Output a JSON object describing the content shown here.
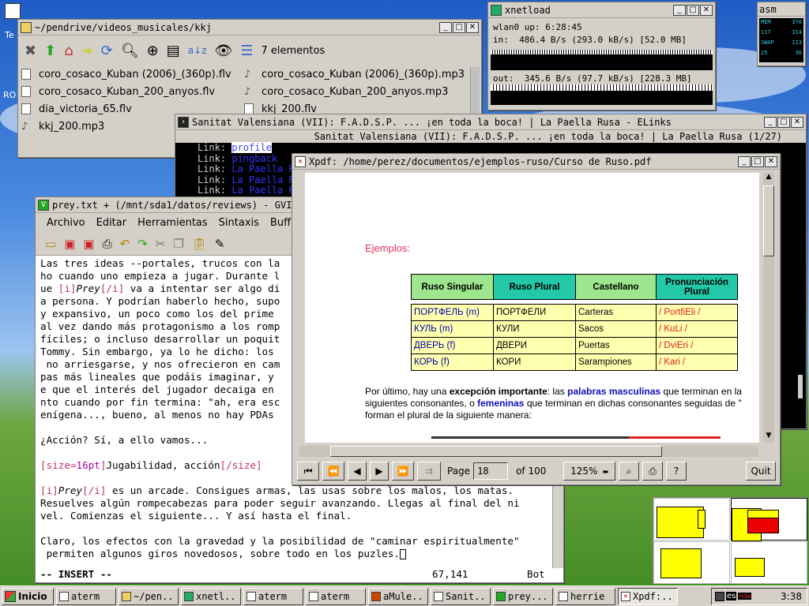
{
  "desktop": {
    "icon_top_label": "Te",
    "icon_left_label": "RO",
    "colors": {
      "sky": "#2f6fd4",
      "grass": "#4c9a2a"
    }
  },
  "filemanager": {
    "title": "~/pendrive/videos_musicales/kkj",
    "count": "7 elementos",
    "files": [
      {
        "name": "coro_cosaco_Kuban (2006)_(360p).flv",
        "icon": "video-file-icon"
      },
      {
        "name": "coro_cosaco_Kuban (2006)_(360p).mp3",
        "icon": "audio-file-icon"
      },
      {
        "name": "coro_cosaco_Kuban_200_anyos.flv",
        "icon": "video-file-icon"
      },
      {
        "name": "coro_cosaco_Kuban_200_anyos.mp3",
        "icon": "audio-file-icon"
      },
      {
        "name": "dia_victoria_65.flv",
        "icon": "video-file-icon"
      },
      {
        "name": "kkj_200.flv",
        "icon": "video-file-icon"
      },
      {
        "name": "kkj_200.mp3",
        "icon": "audio-file-icon"
      }
    ]
  },
  "xnetload": {
    "title": "xnetload",
    "up": "wlan0 up: 6:28:45",
    "in": "in:  486.4 B/s (293.0 kB/s) [52.0 MB]",
    "out": "out:  345.6 B/s (97.7 kB/s) [228.3 MB]"
  },
  "asmon": {
    "title": "asm",
    "rows": [
      {
        "label": "MEM",
        "value": "370"
      },
      {
        "label": "117",
        "value": "314"
      },
      {
        "label": "SWAP",
        "value": "113"
      },
      {
        "label": "25",
        "value": "36"
      }
    ]
  },
  "elinks": {
    "title": "Sanitat Valensiana (VII): F.A.D.S.P. ... ¡en toda la boca! | La Paella Rusa - ELinks",
    "header": "Sanitat Valensiana (VII): F.A.D.S.P. ... ¡en toda la boca! | La Paella Rusa (1/27)",
    "links": [
      {
        "prefix": "Link: ",
        "text": "profile"
      },
      {
        "prefix": "Link: ",
        "text": "pingback"
      },
      {
        "prefix": "Link: ",
        "text": "La Paella R"
      },
      {
        "prefix": "Link: ",
        "text": "La Paella R"
      },
      {
        "prefix": "Link: ",
        "text": "La Paella R"
      }
    ]
  },
  "gvim": {
    "title": "prey.txt + (/mnt/sda1/datos/reviews) - GVIM",
    "menu": [
      "Archivo",
      "Editar",
      "Herramientas",
      "Sintaxis",
      "Buff"
    ],
    "lines": [
      "Las tres ideas --portales, trucos con la",
      "ho cuando uno empieza a jugar. Durante l",
      "ue [i]Prey[/i] va a intentar ser algo di",
      "a persona. Y podrían haberlo hecho, supo",
      "y expansivo, un poco como los del prime",
      "al vez dando más protagonismo a los romp",
      "fíciles; o incluso desarrollar un poquit",
      "Tommy. Sin embargo, ya lo he dicho: los",
      " no arriesgarse, y nos ofrecieron en cam",
      "pas más lineales que podáis imaginar, y",
      "e que el interés del jugador decaiga en",
      "nto cuando por fin termina: \"ah, era esc",
      "enígena..., bueno, al menos no hay PDAs",
      "",
      "¿Acción? Sí, a ello vamos...",
      "",
      "[size=16pt]Jugabilidad, acción[/size]",
      "",
      "[i]Prey[/i] es un arcade. Consigues armas, las usas sobre los malos, los matas.",
      "Resuelves algún rompecabezas para poder seguir avanzando. Llegas al final del ni",
      "vel. Comienzas el siguiente... Y así hasta el final.",
      "",
      "Claro, los efectos con la gravedad y la posibilidad de \"caminar espiritualmente\"",
      " permiten algunos giros novedosos, sobre todo en los puzles."
    ],
    "status_mode": "-- INSERT --",
    "status_pos": "67,141",
    "status_scroll": "Bot"
  },
  "xpdf": {
    "title": "Xpdf: /home/perez/documentos/ejemplos-ruso/Curso de Ruso.pdf",
    "ejemplos": "Ejemplos:",
    "table_head": [
      "Ruso Singular",
      "Ruso Plural",
      "Castellano",
      "Pronunciación Plural"
    ],
    "table_rows": [
      {
        "sing": "ПОРТФЕЛЬ (m)",
        "plur": "ПОРТФЕЛИ",
        "cast": "Carteras",
        "pron": "/ PortfiEli /"
      },
      {
        "sing": "КУЛЬ (m)",
        "plur": "КУЛИ",
        "cast": "Sacos",
        "pron": "/ KuLi /"
      },
      {
        "sing": "ДВЕРЬ (f)",
        "plur": "ДВЕРИ",
        "cast": "Puertas",
        "pron": "/ DviEri /"
      },
      {
        "sing": "КОРЬ (f)",
        "plur": "КОРИ",
        "cast": "Sarampiones",
        "pron": "/ Kari /"
      }
    ],
    "para1": "Por último, hay una",
    "para1_bold": "excepción importante",
    "para1_b": ": las",
    "para1_blue": "palabras masculinas",
    "para1_c": "que terminan en la",
    "para2": "siguientes consonantes, o",
    "para2_blue": "femeninas",
    "para2_b": "que terminan en dichas consonantes seguidas de \"",
    "para3": "forman el plural de la siguiente manera:",
    "page_label": "Page",
    "page_value": "18",
    "page_of": "of 100",
    "zoom": "125%",
    "quit": "Quit"
  },
  "taskbar": {
    "start": "Inicio",
    "tasks": [
      "aterm",
      "~/pen...",
      "xnetl...",
      "aterm",
      "aterm",
      "aMule...",
      "Sanit...",
      "prey...",
      "herrie",
      "Xpdf:..."
    ],
    "active_index": 9,
    "tray": [
      "es",
      "hda"
    ],
    "clock": "3:38"
  }
}
